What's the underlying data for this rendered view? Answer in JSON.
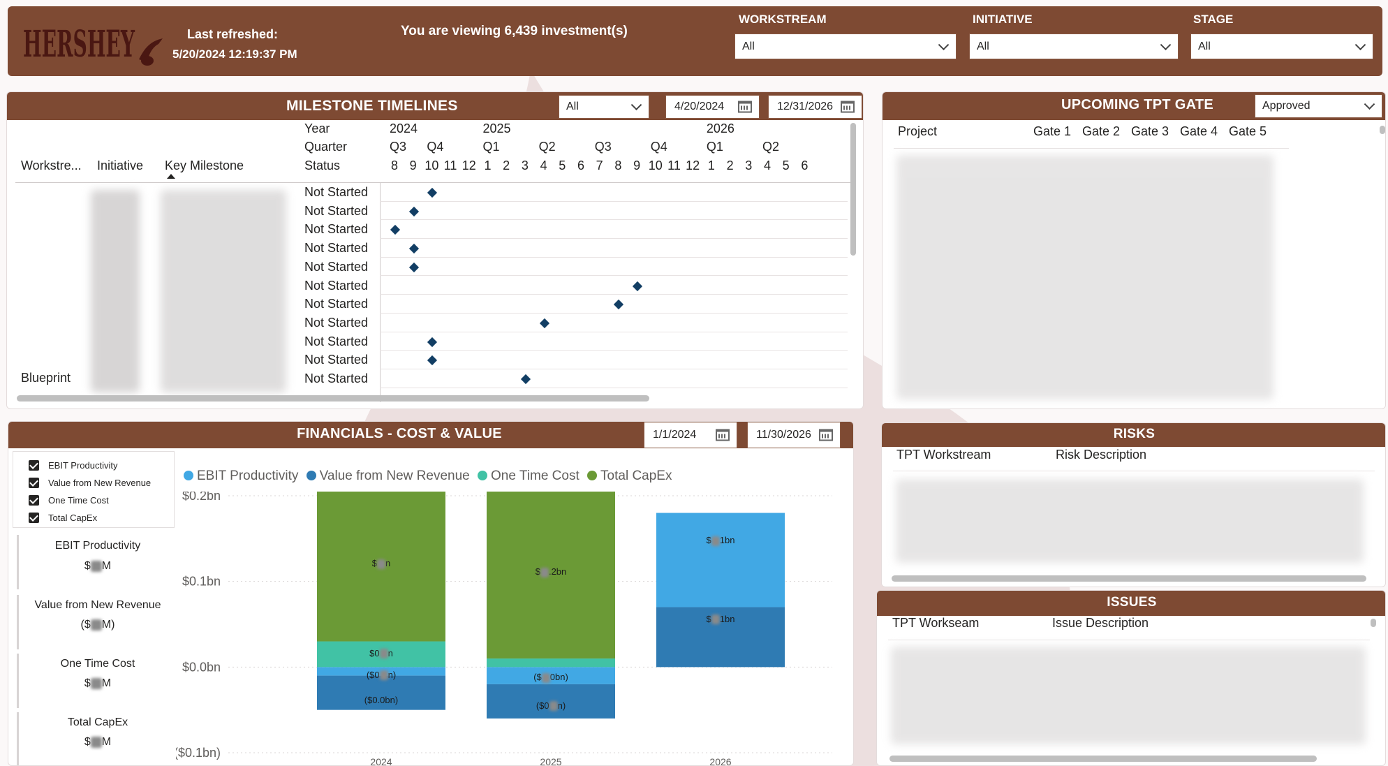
{
  "header": {
    "logo_text": "HERSHEY",
    "last_refreshed_label": "Last refreshed:",
    "last_refreshed_value": "5/20/2024 12:19:37 PM",
    "viewing_text": "You are viewing 6,439 investment(s)",
    "filters": [
      {
        "label": "WORKSTREAM",
        "value": "All"
      },
      {
        "label": "INITIATIVE",
        "value": "All"
      },
      {
        "label": "STAGE",
        "value": "All"
      }
    ]
  },
  "milestones": {
    "title": "MILESTONE TIMELINES",
    "filter_value": "All",
    "date_from": "4/20/2024",
    "date_to": "12/31/2026",
    "row_header_labels": {
      "year": "Year",
      "quarter": "Quarter",
      "status": "Status"
    },
    "columns": {
      "workstream": "Workstre...",
      "initiative": "Initiative",
      "key_milestone": "Key Milestone"
    },
    "years": [
      {
        "label": "2024"
      },
      {
        "label": "2025"
      },
      {
        "label": "2026"
      }
    ],
    "quarters": [
      "Q3",
      "Q4",
      "Q1",
      "Q2",
      "Q3",
      "Q4",
      "Q1",
      "Q2"
    ],
    "months": [
      "8",
      "9",
      "10",
      "11",
      "12",
      "1",
      "2",
      "3",
      "4",
      "5",
      "6",
      "7",
      "8",
      "9",
      "10",
      "11",
      "12",
      "1",
      "2",
      "3",
      "4",
      "5",
      "6"
    ],
    "rows": [
      {
        "status": "Not Started",
        "month_index": 2
      },
      {
        "status": "Not Started",
        "month_index": 1
      },
      {
        "status": "Not Started",
        "month_index": 0
      },
      {
        "status": "Not Started",
        "month_index": 1
      },
      {
        "status": "Not Started",
        "month_index": 1
      },
      {
        "status": "Not Started",
        "month_index": 13
      },
      {
        "status": "Not Started",
        "month_index": 12
      },
      {
        "status": "Not Started",
        "month_index": 8
      },
      {
        "status": "Not Started",
        "month_index": 2
      },
      {
        "status": "Not Started",
        "month_index": 2
      },
      {
        "status": "Not Started",
        "month_index": 7
      }
    ],
    "workstream_label_last": "Blueprint"
  },
  "tpt_gate": {
    "title": "UPCOMING TPT GATE",
    "filter_value": "Approved",
    "columns": [
      "Project",
      "Gate 1",
      "Gate 2",
      "Gate 3",
      "Gate 4",
      "Gate 5"
    ]
  },
  "financials": {
    "title": "FINANCIALS - COST & VALUE",
    "date_from": "1/1/2024",
    "date_to": "11/30/2026",
    "checkboxes": [
      "EBIT Productivity",
      "Value from New Revenue",
      "One Time Cost",
      "Total CapEx"
    ],
    "kpis": [
      {
        "label": "EBIT Productivity",
        "value_prefix": "$",
        "value_suffix": "M"
      },
      {
        "label": "Value from New Revenue",
        "value_prefix": "($",
        "value_suffix": "M)"
      },
      {
        "label": "One Time Cost",
        "value_prefix": "$",
        "value_suffix": "M"
      },
      {
        "label": "Total CapEx",
        "value_prefix": "$",
        "value_suffix": "M"
      }
    ],
    "legend": [
      {
        "name": "EBIT Productivity",
        "color": "#41a8e4"
      },
      {
        "name": "Value from New Revenue",
        "color": "#2f7bb3"
      },
      {
        "name": "One Time Cost",
        "color": "#41c2a5"
      },
      {
        "name": "Total CapEx",
        "color": "#6b9a36"
      }
    ],
    "y_tick_labels": [
      "$0.2bn",
      "$0.1bn",
      "$0.0bn",
      "($0.1bn)"
    ],
    "bar_labels": {
      "b2024_capex": [
        "$",
        "n"
      ],
      "b2024_onetime": [
        "$0",
        "n"
      ],
      "b2024_ebit": [
        "($0",
        "n)"
      ],
      "b2024_vnr": "($0.0bn)",
      "b2025_capex": [
        "$",
        ".2bn"
      ],
      "b2025_ebit": [
        "($",
        "0bn)"
      ],
      "b2025_vnr": [
        "($0",
        "n)"
      ],
      "b2026_vnr": [
        "$",
        "1bn"
      ],
      "b2026_ebit": [
        "$",
        "1bn"
      ]
    }
  },
  "chart_data": {
    "type": "bar",
    "stacked": true,
    "categories": [
      "2024",
      "2025",
      "2026"
    ],
    "ylim": [
      -0.1,
      0.2
    ],
    "series": [
      {
        "name": "EBIT Productivity",
        "values": [
          -0.01,
          -0.02,
          0.11
        ]
      },
      {
        "name": "Value from New Revenue",
        "values": [
          -0.04,
          -0.04,
          0.07
        ]
      },
      {
        "name": "One Time Cost",
        "values": [
          0.03,
          0.01,
          0
        ]
      },
      {
        "name": "Total CapEx",
        "values": [
          0.18,
          0.2,
          0
        ]
      }
    ],
    "grid": true,
    "legend_position": "top"
  },
  "risks": {
    "title": "RISKS",
    "columns": [
      "TPT Workstream",
      "Risk Description"
    ]
  },
  "issues": {
    "title": "ISSUES",
    "columns": [
      "TPT Workseam",
      "Issue Description"
    ]
  }
}
